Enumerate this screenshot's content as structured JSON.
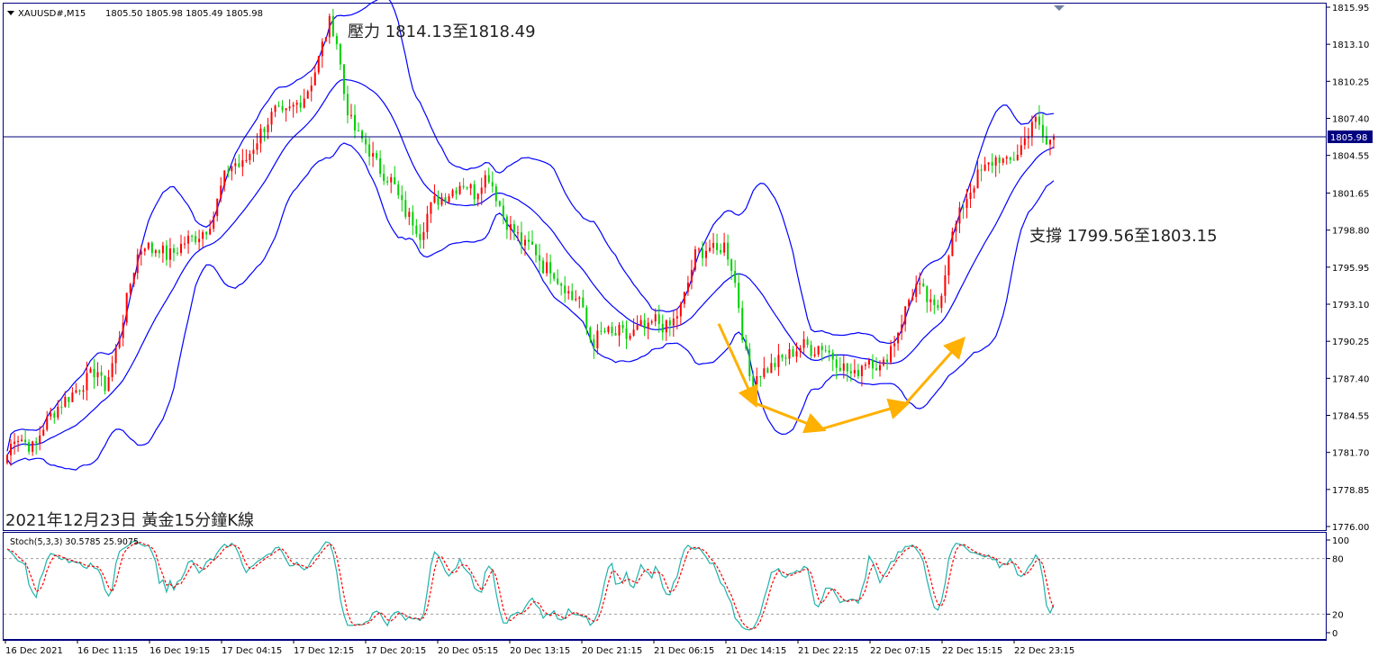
{
  "window": {
    "symbol_header": "XAUUSD#,M15",
    "ohlc": "1805.50 1805.98 1805.49 1805.98"
  },
  "colors": {
    "background": "#ffffff",
    "axis": "#000080",
    "bull_candle": "#ff0000",
    "bear_candle": "#00d000",
    "bollinger": "#0000ff",
    "price_line": "#000080",
    "current_price_bg": "#000080",
    "stoch_main": "#20b2aa",
    "stoch_signal": "#ff0000",
    "arrow": "#ffb000"
  },
  "annotations": {
    "resistance": "壓力 1814.13至1818.49",
    "support": "支撐 1799.56至1803.15",
    "caption": "2021年12月23日 黃金15分鐘K線"
  },
  "current_price_label": "1805.98",
  "indicator_label": "Stoch(5,3,3) 30.5785 25.9075",
  "chart_data": [
    {
      "type": "candlestick",
      "title": "XAUUSD#,M15",
      "y_ticks": [
        "1815.95",
        "1813.10",
        "1810.25",
        "1807.40",
        "1804.55",
        "1801.65",
        "1798.80",
        "1795.95",
        "1793.10",
        "1790.25",
        "1787.40",
        "1784.55",
        "1781.70",
        "1778.85",
        "1776.00"
      ],
      "ylim": [
        1776.0,
        1815.95
      ],
      "current_price": 1805.98,
      "x_ticks": [
        "16 Dec 2021",
        "16 Dec 11:15",
        "16 Dec 19:15",
        "17 Dec 04:15",
        "17 Dec 12:15",
        "17 Dec 20:15",
        "20 Dec 05:15",
        "20 Dec 13:15",
        "20 Dec 21:15",
        "21 Dec 06:15",
        "21 Dec 14:15",
        "21 Dec 22:15",
        "22 Dec 07:15",
        "22 Dec 15:15",
        "22 Dec 23:15"
      ],
      "close_path": [
        1781.5,
        1783,
        1782.8,
        1782.3,
        1782,
        1783.5,
        1784.3,
        1785,
        1785.6,
        1786,
        1786.5,
        1787,
        1787.5,
        1788.2,
        1786.5,
        1788,
        1790,
        1792.5,
        1795,
        1797,
        1797.8,
        1797.2,
        1797.6,
        1796.8,
        1797,
        1797.5,
        1798,
        1798.2,
        1798.5,
        1799,
        1800,
        1802,
        1803.5,
        1804,
        1803.6,
        1804.5,
        1805.5,
        1806.5,
        1807.3,
        1808,
        1807.5,
        1808,
        1808.5,
        1809,
        1810,
        1811.5,
        1813.5,
        1815,
        1813,
        1809,
        1807,
        1806,
        1805.5,
        1804.5,
        1803.5,
        1803,
        1802.5,
        1801,
        1800,
        1799.5,
        1798.5,
        1800,
        1801,
        1801.3,
        1801.6,
        1802,
        1802.5,
        1802.2,
        1801.5,
        1802.8,
        1803,
        1801.5,
        1800,
        1799,
        1798.5,
        1797.5,
        1797.7,
        1797,
        1795.8,
        1796,
        1795,
        1794.5,
        1793.5,
        1793.8,
        1791.5,
        1790,
        1790.8,
        1791,
        1790.6,
        1791,
        1790.5,
        1790.9,
        1791.4,
        1791,
        1792,
        1791.5,
        1791.2,
        1792,
        1793,
        1795,
        1797,
        1797.2,
        1797.5,
        1797,
        1797.8,
        1796.5,
        1794,
        1790,
        1787,
        1787.8,
        1788,
        1788.3,
        1788.7,
        1789,
        1789.4,
        1789.8,
        1790,
        1789.5,
        1790,
        1789.6,
        1789,
        1788.5,
        1788,
        1787.5,
        1788.4,
        1789,
        1788.6,
        1788,
        1789.5,
        1790.5,
        1792,
        1793.5,
        1794.5,
        1794,
        1793,
        1792.5,
        1795,
        1798,
        1799.5,
        1801,
        1802,
        1803,
        1803.5,
        1804,
        1804.5,
        1803.8,
        1804.2,
        1805,
        1806,
        1807.5,
        1806.5,
        1805.3,
        1805.98
      ],
      "bollinger_window": 20,
      "bollinger_k": 2,
      "annotation_points": [
        {
          "label": "resistance",
          "price": 1816.5
        },
        {
          "label": "support",
          "price": 1801.8
        }
      ],
      "arrow_path_prices": [
        1791.6,
        1785.5,
        1783.5,
        1785.4,
        1790.3
      ]
    },
    {
      "type": "line",
      "title": "Stoch(5,3,3)",
      "values_text": "30.5785 25.9075",
      "ylim": [
        0,
        100
      ],
      "levels": [
        20,
        80
      ],
      "y_ticks": [
        "100",
        "80",
        "20",
        "0"
      ],
      "series": [
        {
          "name": "%K (main)",
          "last_value": 30.5785
        },
        {
          "name": "%D (signal)",
          "last_value": 25.9075
        }
      ]
    }
  ]
}
